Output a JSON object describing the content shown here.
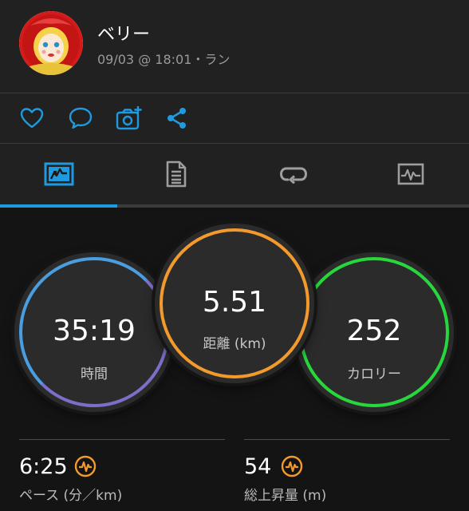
{
  "activity": {
    "user_name": "ベリー",
    "meta": "09/03 @ 18:01・ラン"
  },
  "actions": {
    "icons": [
      "heart-icon",
      "comment-icon",
      "add-photo-icon",
      "share-icon"
    ],
    "accent": "#1e9be0"
  },
  "tabs": {
    "items": [
      "summary-tab",
      "details-tab",
      "laps-tab",
      "charts-tab"
    ],
    "selected": 0
  },
  "rings": {
    "time": {
      "value": "35:19",
      "label": "時間",
      "color": "#5a8fd9"
    },
    "distance": {
      "value": "5.51",
      "label": "距離 (km)",
      "color": "#f39a2c"
    },
    "calories": {
      "value": "252",
      "label": "カロリー",
      "color": "#26d83c"
    }
  },
  "stats": {
    "pace": {
      "value": "6:25",
      "label": "ペース (分／km)",
      "icon": "activity-badge-icon"
    },
    "elevation": {
      "value": "54",
      "label": "総上昇量 (m)",
      "icon": "activity-badge-icon"
    },
    "badge_color": "#f39a2c"
  }
}
